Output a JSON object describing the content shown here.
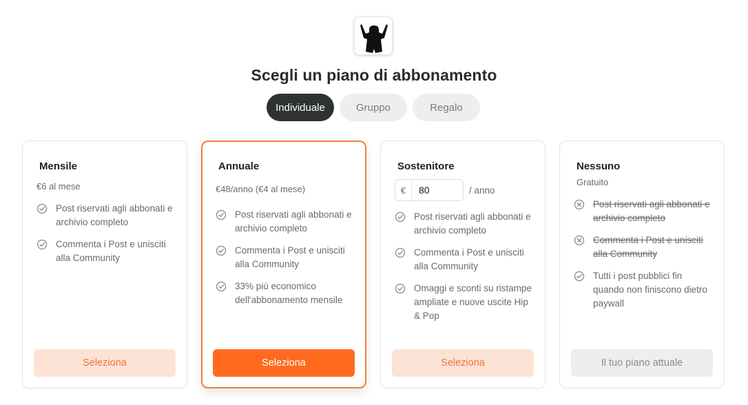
{
  "header": {
    "title": "Scegli un piano di abbonamento"
  },
  "tabs": [
    {
      "label": "Individuale"
    },
    {
      "label": "Gruppo"
    },
    {
      "label": "Regalo"
    }
  ],
  "plans": [
    {
      "name": "Mensile",
      "price": "€6 al mese",
      "features": [
        {
          "text": "Post riservati agli abbonati e archivio completo",
          "icon": "check-circle-icon"
        },
        {
          "text": "Commenta i Post e unisciti alla Community",
          "icon": "check-circle-icon"
        }
      ],
      "button": "Seleziona"
    },
    {
      "name": "Annuale",
      "price": "€48/anno (€4 al mese)",
      "features": [
        {
          "text": "Post riservati agli abbonati e archivio completo",
          "icon": "check-circle-icon"
        },
        {
          "text": "Commenta i Post e unisciti alla Community",
          "icon": "check-circle-icon"
        },
        {
          "text": "33% più economico dell'abbonamento mensile",
          "icon": "check-circle-icon"
        }
      ],
      "button": "Seleziona"
    },
    {
      "name": "Sostenitore",
      "currency": "€",
      "amount": "80",
      "per": "/ anno",
      "features": [
        {
          "text": "Post riservati agli abbonati e archivio completo",
          "icon": "check-circle-icon"
        },
        {
          "text": "Commenta i Post e unisciti alla Community",
          "icon": "check-circle-icon"
        },
        {
          "text": "Omaggi e sconti su ristampe ampliate e nuove uscite Hip & Pop",
          "icon": "check-circle-icon"
        }
      ],
      "button": "Seleziona"
    },
    {
      "name": "Nessuno",
      "price": "Gratuito",
      "features": [
        {
          "text": "Post riservati agli abbonati e archivio completo",
          "icon": "x-circle-icon"
        },
        {
          "text": "Commenta i Post e unisciti alla Community",
          "icon": "x-circle-icon"
        },
        {
          "text": "Tutti i post pubblici fin quando non finiscono dietro paywall",
          "icon": "check-circle-icon"
        }
      ],
      "button": "Il tuo piano attuale"
    }
  ],
  "colors": {
    "accent": "#ff6a1f",
    "accent_light": "#fde3d6",
    "dark_tab": "#2f3233",
    "muted_text": "#6a6a6a"
  }
}
